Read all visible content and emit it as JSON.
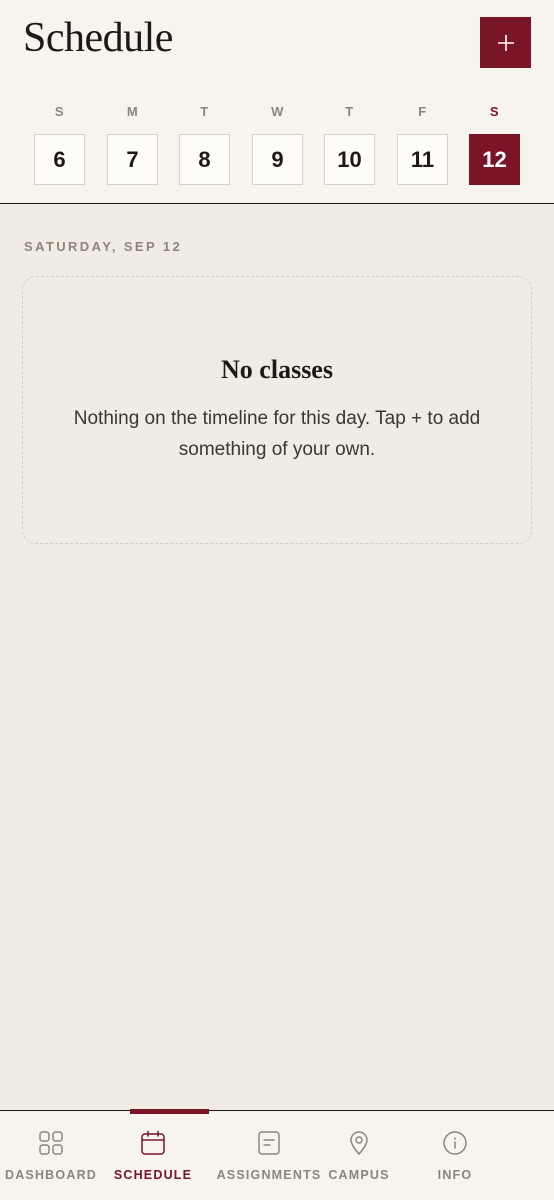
{
  "header": {
    "title": "Schedule",
    "add_icon": "plus-icon"
  },
  "week": {
    "days": [
      {
        "dow": "S",
        "num": "6"
      },
      {
        "dow": "M",
        "num": "7"
      },
      {
        "dow": "T",
        "num": "8"
      },
      {
        "dow": "W",
        "num": "9"
      },
      {
        "dow": "T",
        "num": "10"
      },
      {
        "dow": "F",
        "num": "11"
      },
      {
        "dow": "S",
        "num": "12",
        "selected": true
      }
    ]
  },
  "main": {
    "date_heading": "SATURDAY, SEP 12",
    "empty_title": "No classes",
    "empty_text": "Nothing on the timeline for this day. Tap + to add something of your own."
  },
  "tabbar": {
    "items": [
      {
        "label": "DASHBOARD",
        "icon": "grid-icon"
      },
      {
        "label": "SCHEDULE",
        "icon": "calendar-icon",
        "active": true
      },
      {
        "label": "ASSIGNMENTS",
        "icon": "document-icon"
      },
      {
        "label": "CAMPUS",
        "icon": "map-pin-icon"
      },
      {
        "label": "INFO",
        "icon": "info-icon"
      }
    ]
  },
  "colors": {
    "accent": "#7a1528",
    "background": "#f1ece3",
    "header_background": "#f7f4ee",
    "muted_text": "#8d857a"
  }
}
